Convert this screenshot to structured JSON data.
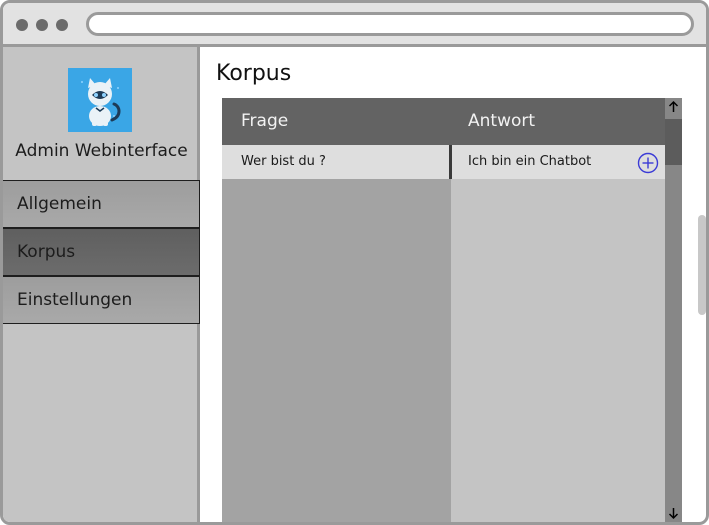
{
  "app": {
    "title": "Admin Webinterface"
  },
  "sidebar": {
    "items": [
      {
        "label": "Allgemein"
      },
      {
        "label": "Korpus"
      },
      {
        "label": "Einstellungen"
      }
    ]
  },
  "main": {
    "title": "Korpus",
    "table": {
      "columns": [
        "Frage",
        "Antwort"
      ],
      "rows": [
        {
          "frage": "Wer bist du ?",
          "antwort": "Ich bin ein Chatbot"
        }
      ]
    }
  },
  "icons": {
    "logo": "cat-logo-icon",
    "add": "plus-circle-icon",
    "scroll_up": "arrow-up-icon",
    "scroll_down": "arrow-down-icon"
  },
  "colors": {
    "logo_bg": "#3aa6e6",
    "add_icon": "#3b3bd6",
    "header_bg": "#636363",
    "nav_active": "#646464"
  }
}
